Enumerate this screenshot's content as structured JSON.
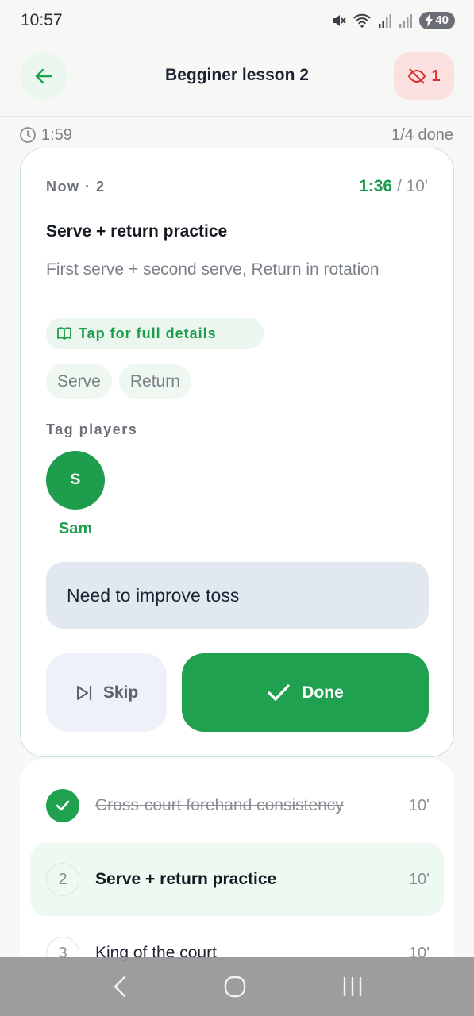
{
  "status_bar": {
    "time": "10:57",
    "battery": "40",
    "icons": [
      "mute-icon",
      "wifi-icon",
      "signal-icon",
      "signal-icon"
    ]
  },
  "header": {
    "title": "Begginer lesson 2",
    "back_icon": "arrow-left-icon",
    "badge_icon": "eye-off-icon",
    "badge_count": "1",
    "badge_color": "#d62e2e"
  },
  "session": {
    "elapsed": "1:59",
    "progress": "1/4 done"
  },
  "current_drill": {
    "now_label": "Now · 2",
    "timer_elapsed": "1:36",
    "timer_total": "/ 10'",
    "title": "Serve + return practice",
    "description": "First serve + second serve, Return in rotation",
    "details_label": "Tap for full details",
    "chips": [
      "Serve",
      "Return"
    ],
    "tag_players_label": "Tag players",
    "player": {
      "initial": "S",
      "name": "Sam"
    },
    "note_value": "Need to improve toss",
    "skip_label": "Skip",
    "done_label": "Done",
    "accent_color": "#1fa14f"
  },
  "drill_list": [
    {
      "number": "",
      "name": "Cross-court forehand consistency",
      "duration": "10'",
      "state": "done"
    },
    {
      "number": "2",
      "name": "Serve + return practice",
      "duration": "10'",
      "state": "current"
    },
    {
      "number": "3",
      "name": "King of the court",
      "duration": "10'",
      "state": "upcoming"
    }
  ]
}
